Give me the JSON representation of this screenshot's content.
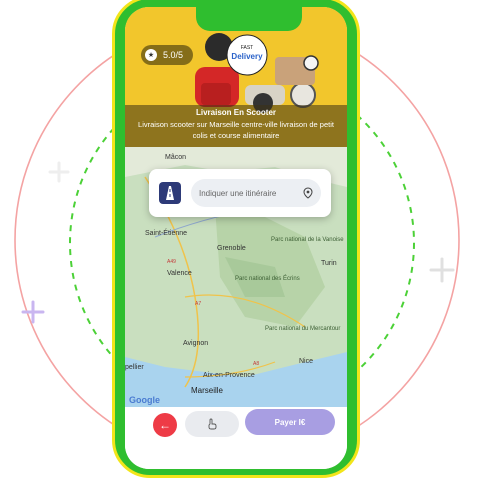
{
  "hero": {
    "rating": "5.0/5",
    "title": "Livraison En Scooter",
    "description": "Livraison scooter sur Marseille centre-ville livraison de petit colis et course alimentaire",
    "sign_top": "FAST",
    "sign_main": "Delivery"
  },
  "search": {
    "placeholder": "Indiquer une itinéraire"
  },
  "map": {
    "places": [
      {
        "name": "Mâcon"
      },
      {
        "name": "Saint-Étienne"
      },
      {
        "name": "Grenoble"
      },
      {
        "name": "Parc national de la Vanoise"
      },
      {
        "name": "Turin"
      },
      {
        "name": "Valence"
      },
      {
        "name": "Parc national des Écrins"
      },
      {
        "name": "Parc national du Mercantour"
      },
      {
        "name": "Avignon"
      },
      {
        "name": "Nice"
      },
      {
        "name": "Aix-en-Provence"
      },
      {
        "name": "Marseille"
      },
      {
        "name": "pellier"
      },
      {
        "name": "A49"
      },
      {
        "name": "A7"
      },
      {
        "name": "A8"
      }
    ],
    "logo": "Google"
  },
  "bottom": {
    "pay_label": "Payer I€"
  },
  "colors": {
    "phone_frame": "#2fbe2f",
    "phone_outline": "#f2e51a",
    "accent_red": "#ee3b46",
    "accent_purple": "#a89ee2",
    "hero_bg": "#f2c62c"
  }
}
